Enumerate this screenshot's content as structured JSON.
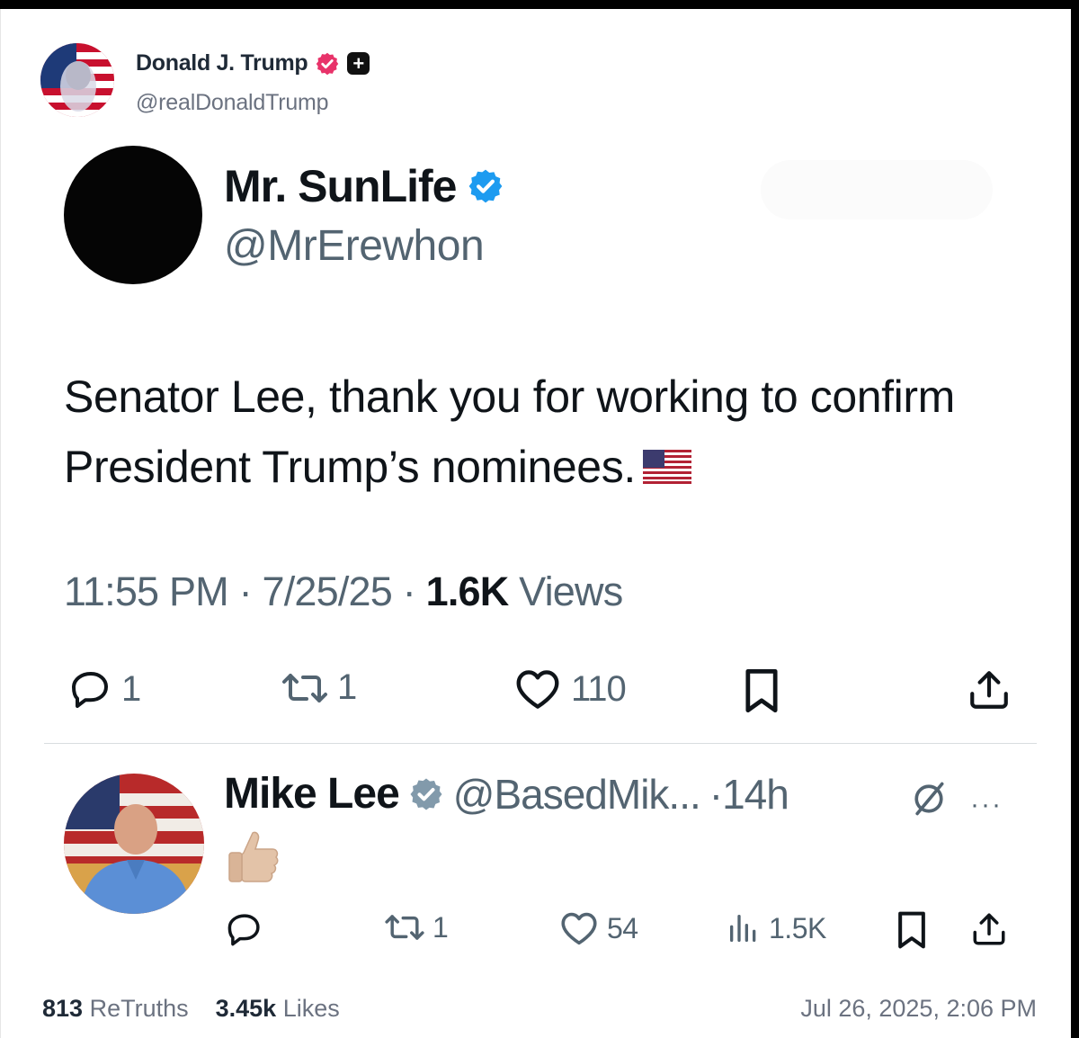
{
  "truth_header": {
    "name": "Donald J. Trump",
    "handle": "@realDonaldTrump",
    "verified_color": "#e8336a"
  },
  "embedded_post": {
    "name": "Mr. SunLife",
    "handle": "@MrErewhon",
    "verified_color": "#1d9bf0",
    "body": "Senator Lee, thank you for working to confirm President Trump’s nominees.",
    "time": "11:55 PM",
    "date": "7/25/25",
    "views_count": "1.6K",
    "views_label": "Views",
    "separator": "·",
    "actions": {
      "replies": "1",
      "reposts": "1",
      "likes": "110"
    }
  },
  "reply": {
    "name": "Mike Lee",
    "handle": "@BasedMik...",
    "age": "·14h",
    "more": "···",
    "actions": {
      "reposts": "1",
      "likes": "54",
      "views": "1.5K"
    }
  },
  "footer": {
    "retruths_count": "813",
    "retruths_label": "ReTruths",
    "likes_count": "3.45k",
    "likes_label": "Likes",
    "date": "Jul 26, 2025, 2:06 PM"
  },
  "colors": {
    "text": "#0f1419",
    "muted": "#536471",
    "x_blue": "#1d9bf0",
    "truth_pink": "#e8336a"
  }
}
